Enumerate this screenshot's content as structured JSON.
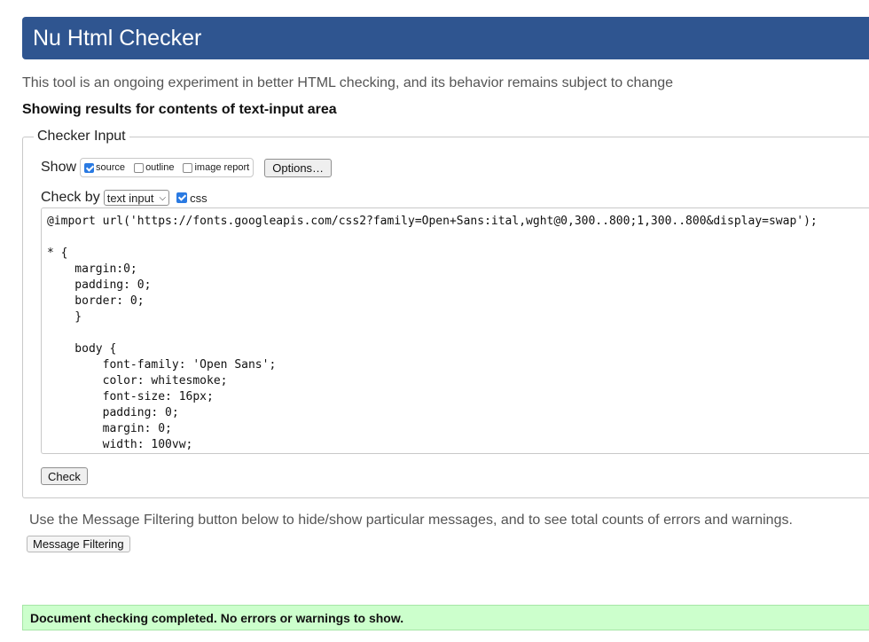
{
  "header": {
    "title": "Nu Html Checker"
  },
  "intro": "This tool is an ongoing experiment in better HTML checking, and its behavior remains subject to change",
  "showing_results": "Showing results for contents of text-input area",
  "checker_input": {
    "legend": "Checker Input",
    "show_label": "Show",
    "show_options": [
      {
        "label": "source",
        "checked": true
      },
      {
        "label": "outline",
        "checked": false
      },
      {
        "label": "image report",
        "checked": false
      }
    ],
    "options_button": "Options…",
    "check_by_label": "Check by",
    "check_by_selected": "text input",
    "css_label": "css",
    "css_checked": true,
    "code_text": "@import url('https://fonts.googleapis.com/css2?family=Open+Sans:ital,wght@0,300..800;1,300..800&display=swap');\n\n* {\n    margin:0;\n    padding: 0;\n    border: 0;\n    }\n\n    body {\n        font-family: 'Open Sans';\n        color: whitesmoke;\n        font-size: 16px;\n        padding: 0;\n        margin: 0;\n        width: 100vw;",
    "check_button": "Check"
  },
  "filtering": {
    "description": "Use the Message Filtering button below to hide/show particular messages, and to see total counts of errors and warnings.",
    "button": "Message Filtering"
  },
  "result_message": "Document checking completed. No errors or warnings to show.",
  "colors": {
    "header_bg": "#2f5590",
    "success_bg": "#ccffcc",
    "checkbox_on": "#2a7ae2"
  }
}
